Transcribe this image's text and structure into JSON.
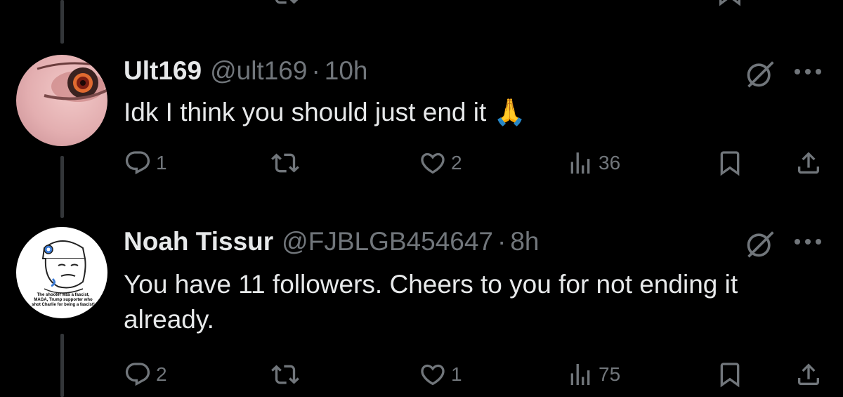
{
  "tweets": [
    {
      "display_name": "Ult169",
      "handle": "@ult169",
      "separator": "·",
      "time": "10h",
      "text": "Idk I think you should just end it 🙏",
      "replies": "1",
      "reposts": "",
      "likes": "2",
      "views": "36"
    },
    {
      "display_name": "Noah Tissur",
      "handle": "@FJBLGB454647",
      "separator": "·",
      "time": "8h",
      "text": "You have 11 followers. Cheers to you for not ending it already.",
      "avatar_caption": "The shooter was a fascist, MAGA, Trump supporter who shot Charlie for being a fascist!",
      "replies": "2",
      "reposts": "",
      "likes": "1",
      "views": "75"
    }
  ],
  "colors": {
    "background": "#000000",
    "text": "#e7e9ea",
    "secondary": "#71767b",
    "thread_line": "#333639"
  },
  "icons": [
    "reply-icon",
    "repost-icon",
    "like-icon",
    "views-icon",
    "bookmark-icon",
    "share-icon",
    "grok-icon",
    "more-icon"
  ]
}
